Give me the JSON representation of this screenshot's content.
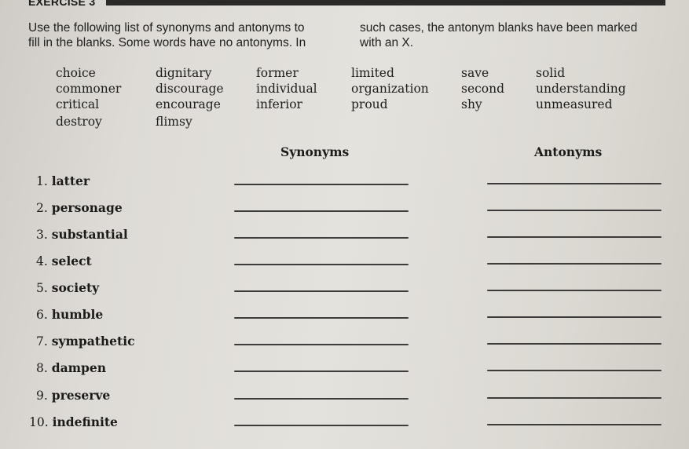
{
  "exercise": {
    "title": "EXERCISE 3"
  },
  "instructions": {
    "left_lines": [
      "Use the following list of synonyms and antonyms to",
      "fill in the blanks. Some words have no antonyms. In"
    ],
    "right_lines": [
      "such cases, the antonym blanks have been marked",
      "with an X."
    ]
  },
  "word_bank": {
    "columns": [
      [
        "choice",
        "commoner",
        "critical",
        "destroy"
      ],
      [
        "dignitary",
        "discourage",
        "encourage",
        "flimsy"
      ],
      [
        "former",
        "individual",
        "inferior"
      ],
      [
        "limited",
        "organization",
        "proud"
      ],
      [
        "save",
        "second",
        "shy"
      ],
      [
        "solid",
        "understanding",
        "unmeasured"
      ]
    ]
  },
  "table": {
    "headers": {
      "synonyms": "Synonyms",
      "antonyms": "Antonyms"
    },
    "items": [
      {
        "number": "1.",
        "word": "latter",
        "synonym": "",
        "antonym": ""
      },
      {
        "number": "2.",
        "word": "personage",
        "synonym": "",
        "antonym": ""
      },
      {
        "number": "3.",
        "word": "substantial",
        "synonym": "",
        "antonym": ""
      },
      {
        "number": "4.",
        "word": "select",
        "synonym": "",
        "antonym": ""
      },
      {
        "number": "5.",
        "word": "society",
        "synonym": "",
        "antonym": ""
      },
      {
        "number": "6.",
        "word": "humble",
        "synonym": "",
        "antonym": ""
      },
      {
        "number": "7.",
        "word": "sympathetic",
        "synonym": "",
        "antonym": ""
      },
      {
        "number": "8.",
        "word": "dampen",
        "synonym": "",
        "antonym": ""
      },
      {
        "number": "9.",
        "word": "preserve",
        "synonym": "",
        "antonym": ""
      },
      {
        "number": "10.",
        "word": "indefinite",
        "synonym": "",
        "antonym": ""
      }
    ]
  }
}
